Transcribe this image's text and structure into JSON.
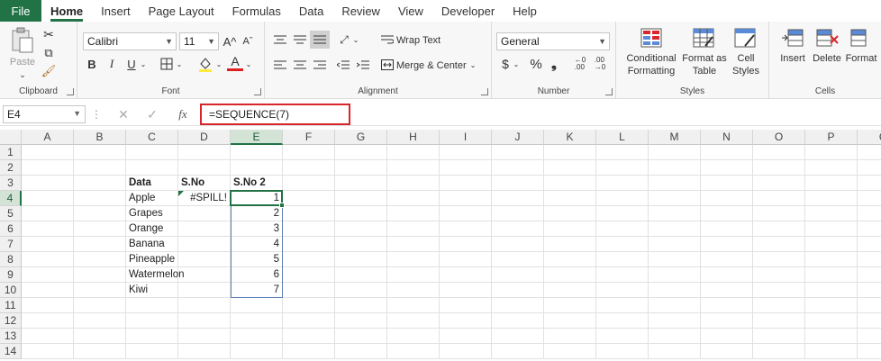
{
  "menu": {
    "file": "File",
    "tabs": [
      "Home",
      "Insert",
      "Page Layout",
      "Formulas",
      "Data",
      "Review",
      "View",
      "Developer",
      "Help"
    ]
  },
  "ribbon": {
    "clipboard": {
      "paste": "Paste",
      "label": "Clipboard"
    },
    "font": {
      "name": "Calibri",
      "size": "11",
      "label": "Font",
      "bold": "B",
      "italic": "I",
      "underline": "U",
      "grow": "A^",
      "shrink": "Aˇ",
      "font_color": "A"
    },
    "alignment": {
      "wrap": "Wrap Text",
      "merge": "Merge & Center",
      "label": "Alignment"
    },
    "number": {
      "format": "General",
      "label": "Number",
      "currency": "$",
      "percent": "%",
      "comma": "❟"
    },
    "styles": {
      "conditional": "Conditional",
      "conditional2": "Formatting",
      "format_as": "Format as",
      "format_as2": "Table",
      "cell": "Cell",
      "cell2": "Styles",
      "label": "Styles"
    },
    "cells": {
      "insert": "Insert",
      "delete": "Delete",
      "format": "Format",
      "label": "Cells"
    }
  },
  "formula_bar": {
    "name_box": "E4",
    "fx": "fx",
    "formula": "=SEQUENCE(7)"
  },
  "sheet": {
    "columns": [
      "A",
      "B",
      "C",
      "D",
      "E",
      "F",
      "G",
      "H",
      "I",
      "J",
      "K",
      "L",
      "M",
      "N",
      "O",
      "P",
      "Q"
    ],
    "selected_column": "E",
    "rows": [
      "1",
      "2",
      "3",
      "4",
      "5",
      "6",
      "7",
      "8",
      "9",
      "10",
      "11",
      "12",
      "13",
      "14"
    ],
    "selected_row": "4",
    "headers": {
      "data": "Data",
      "sno": "S.No",
      "sno2": "S.No 2"
    },
    "fruits": [
      "Apple",
      "Grapes",
      "Orange",
      "Banana",
      "Pineapple",
      "Watermelon",
      "Kiwi"
    ],
    "spill_error": "#SPILL!",
    "sequence": [
      "1",
      "2",
      "3",
      "4",
      "5",
      "6",
      "7"
    ]
  },
  "colors": {
    "accent": "#217346",
    "highlight_box": "#d9262b",
    "selection": "#217346"
  }
}
